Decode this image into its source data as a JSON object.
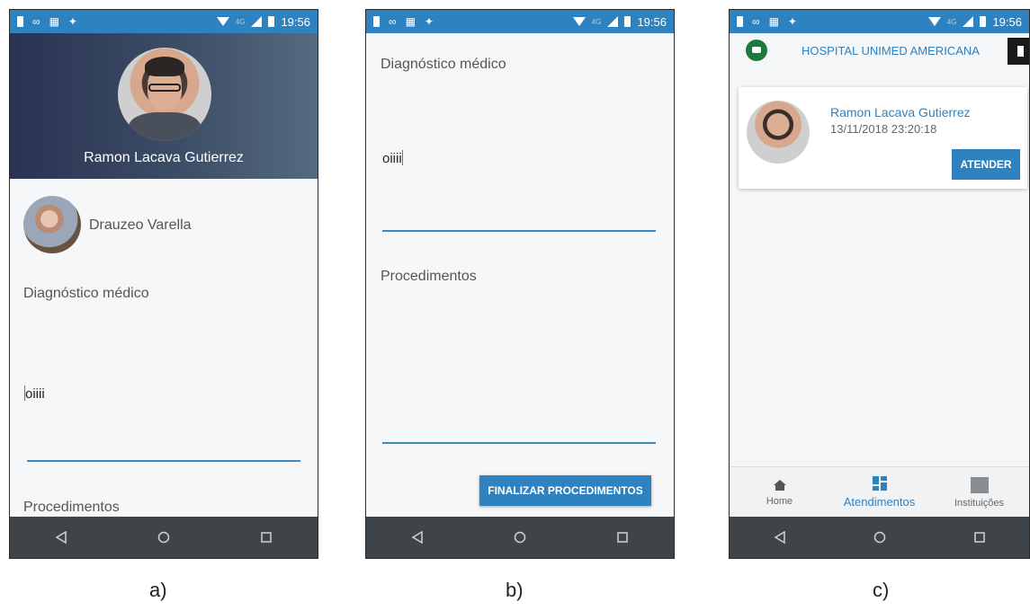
{
  "status_bar": {
    "time": "19:56",
    "network": "4G"
  },
  "phone_a": {
    "patient_name": "Ramon Lacava Gutierrez",
    "doctor_name": "Drauzeo Varella",
    "diagnosis_label": "Diagnóstico médico",
    "diagnosis_value": "oiiii",
    "procedures_label": "Procedimentos"
  },
  "phone_b": {
    "diagnosis_label": "Diagnóstico médico",
    "diagnosis_value": "oiiii",
    "procedures_label": "Procedimentos",
    "finalize_button": "FINALIZAR PROCEDIMENTOS"
  },
  "phone_c": {
    "hospital_name": "HOSPITAL UNIMED AMERICANA",
    "patient_name": "Ramon Lacava Gutierrez",
    "datetime": "13/11/2018 23:20:18",
    "attend_button": "ATENDER",
    "tabs": [
      {
        "label": "Home",
        "icon": "home-icon"
      },
      {
        "label": "Atendimentos",
        "icon": "dashboard-icon",
        "active": true
      },
      {
        "label": "Instituições",
        "icon": "building-icon"
      }
    ]
  },
  "captions": [
    "a)",
    "b)",
    "c)"
  ],
  "colors": {
    "primary": "#2f82c0",
    "navbar": "#3f4448",
    "header_gradient_start": "#2a3352"
  }
}
